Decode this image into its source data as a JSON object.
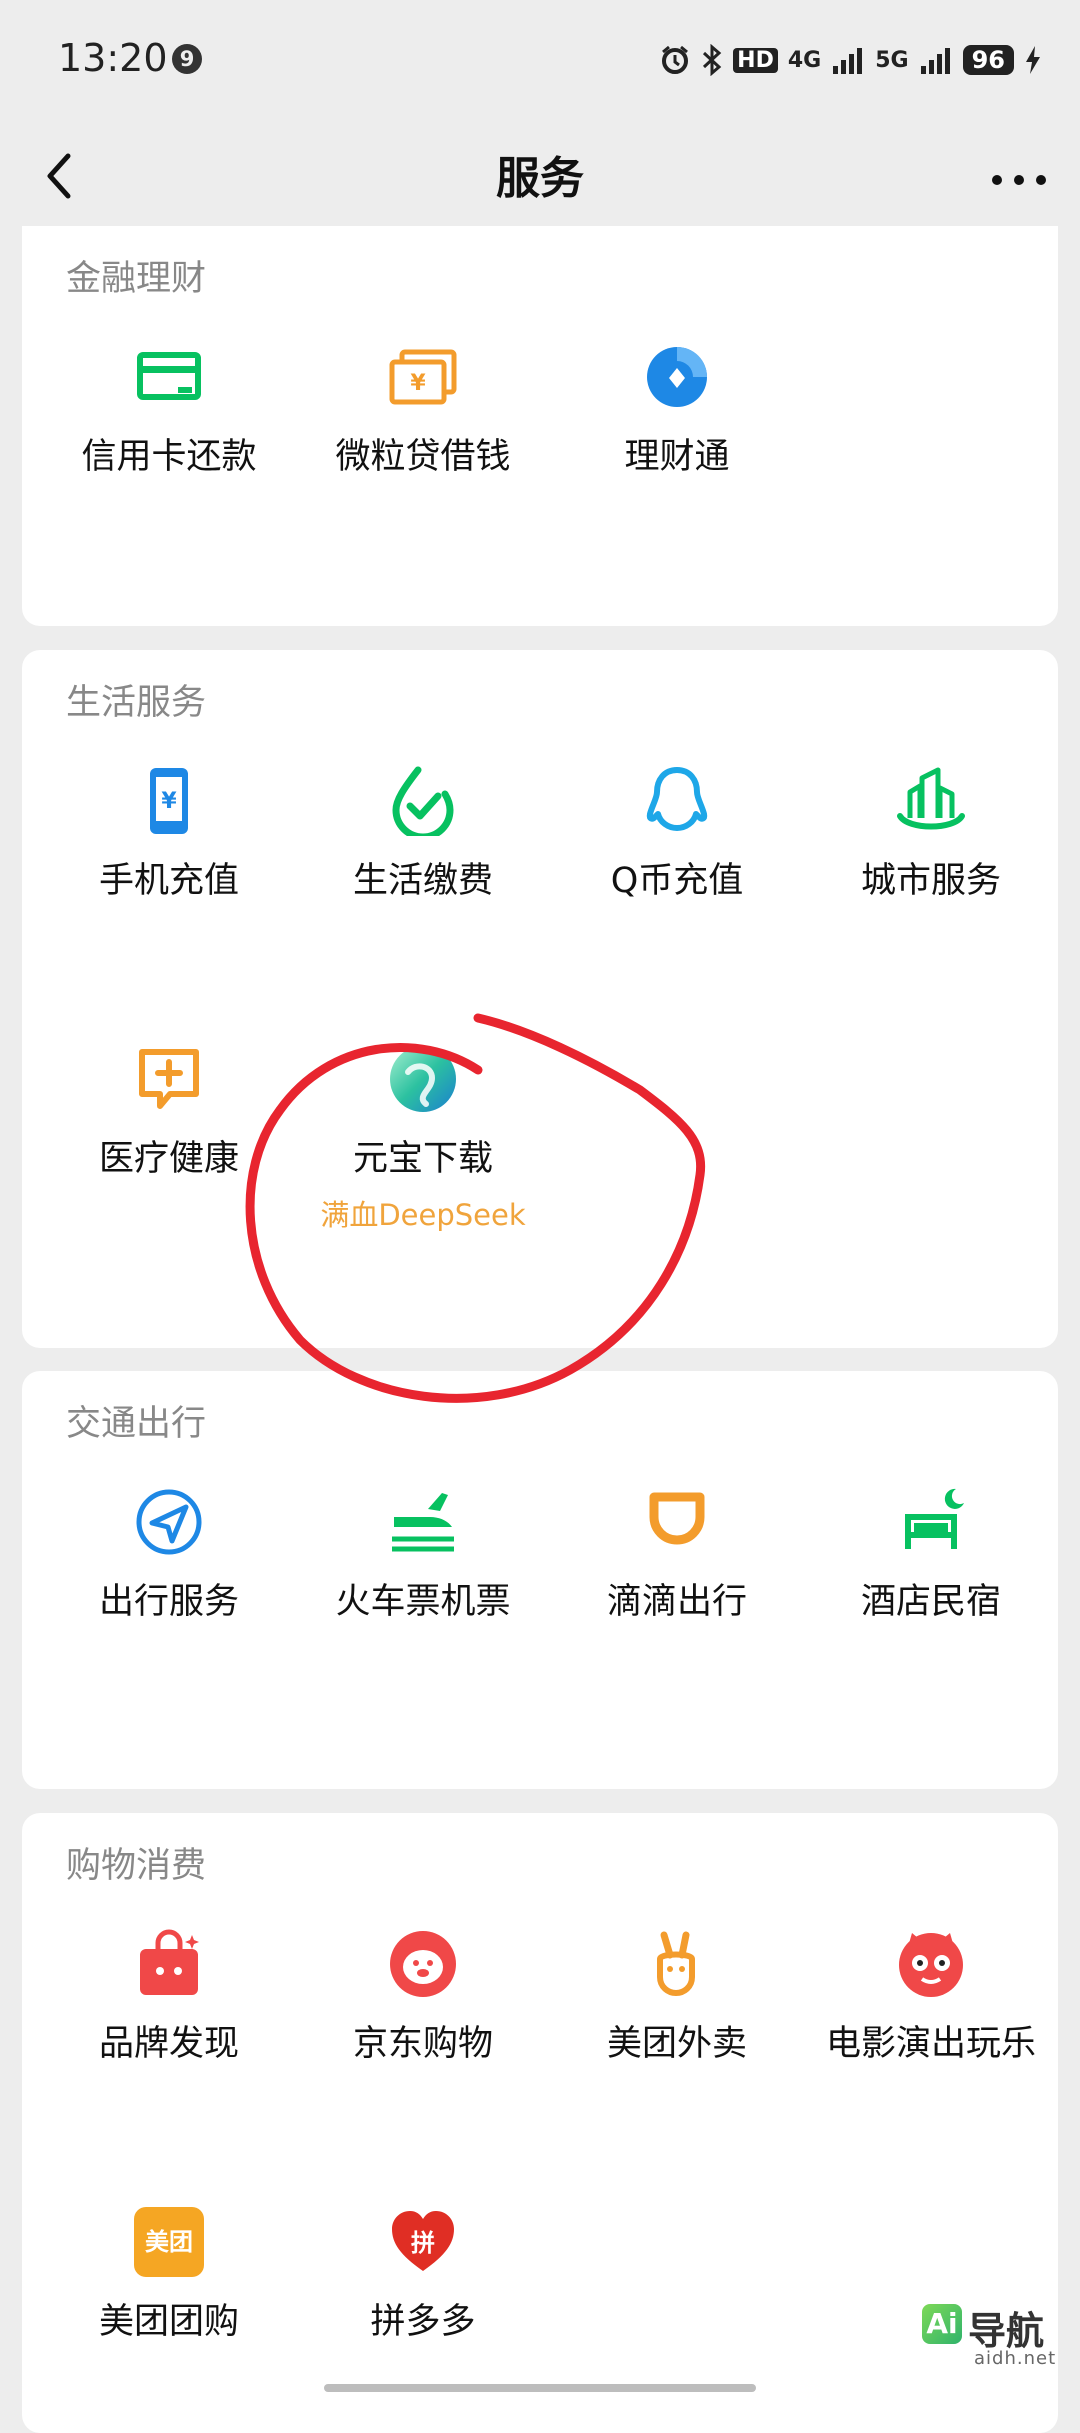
{
  "status_bar": {
    "time": "13:20",
    "notification_count": "9",
    "network_hd": "HD",
    "network_4g": "4G",
    "network_5g": "5G",
    "battery": "96"
  },
  "nav": {
    "title": "服务"
  },
  "sections": {
    "finance": {
      "title": "金融理财",
      "items": [
        {
          "label": "信用卡还款"
        },
        {
          "label": "微粒贷借钱"
        },
        {
          "label": "理财通"
        }
      ]
    },
    "life": {
      "title": "生活服务",
      "items": [
        {
          "label": "手机充值"
        },
        {
          "label": "生活缴费"
        },
        {
          "label": "Q币充值"
        },
        {
          "label": "城市服务"
        },
        {
          "label": "医疗健康"
        },
        {
          "label": "元宝下载",
          "sub": "满血DeepSeek"
        }
      ]
    },
    "transport": {
      "title": "交通出行",
      "items": [
        {
          "label": "出行服务"
        },
        {
          "label": "火车票机票"
        },
        {
          "label": "滴滴出行"
        },
        {
          "label": "酒店民宿"
        }
      ]
    },
    "shopping": {
      "title": "购物消费",
      "items": [
        {
          "label": "品牌发现"
        },
        {
          "label": "京东购物"
        },
        {
          "label": "美团外卖"
        },
        {
          "label": "电影演出玩乐"
        },
        {
          "label": "美团团购",
          "badge": "美团"
        },
        {
          "label": "拼多多",
          "badge": "拼"
        }
      ]
    }
  },
  "watermark": {
    "logo": "Ai",
    "text": "导航",
    "url": "aidh.net"
  },
  "colors": {
    "green": "#07c160",
    "orange": "#f39c2c",
    "blue": "#1e88e5",
    "red": "#f04848",
    "annotation": "#e8252f"
  }
}
